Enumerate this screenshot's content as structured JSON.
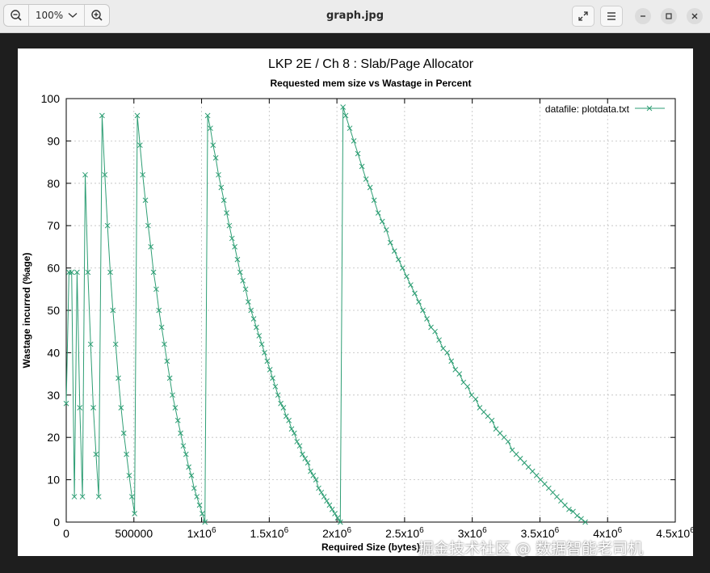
{
  "window": {
    "title": "graph.jpg",
    "zoom_level": "100%"
  },
  "icons": {
    "zoom_out": "zoom-out-icon",
    "zoom_in": "zoom-in-icon",
    "fullscreen": "fullscreen-icon",
    "menu": "hamburger-menu-icon",
    "minimize": "minimize-icon",
    "maximize": "maximize-icon",
    "close": "close-icon"
  },
  "watermark": "掘金技术社区 @ 数据智能老司机",
  "chart_data": {
    "type": "line",
    "title": "LKP 2E / Ch 8 : Slab/Page Allocator",
    "subtitle": "Requested mem size vs Wastage in Percent",
    "xlabel": "Required Size (bytes)",
    "ylabel": "Wastage incurred (%age)",
    "xlim": [
      0,
      4500000
    ],
    "ylim": [
      0,
      100
    ],
    "x_ticks": [
      {
        "value": 0,
        "label": "0"
      },
      {
        "value": 500000,
        "label": "500000"
      },
      {
        "value": 1000000,
        "label": "1x10",
        "sup": "6"
      },
      {
        "value": 1500000,
        "label": "1.5x10",
        "sup": "6"
      },
      {
        "value": 2000000,
        "label": "2x10",
        "sup": "6"
      },
      {
        "value": 2500000,
        "label": "2.5x10",
        "sup": "6"
      },
      {
        "value": 3000000,
        "label": "3x10",
        "sup": "6"
      },
      {
        "value": 3500000,
        "label": "3.5x10",
        "sup": "6"
      },
      {
        "value": 4000000,
        "label": "4x10",
        "sup": "6"
      },
      {
        "value": 4500000,
        "label": "4.5x10",
        "sup": "6"
      }
    ],
    "y_ticks": [
      0,
      10,
      20,
      30,
      40,
      50,
      60,
      70,
      80,
      90,
      100
    ],
    "grid": true,
    "legend_position": "top-right",
    "colors": {
      "series": "#2e9e74"
    },
    "series": [
      {
        "name": "datafile: plotdata.txt",
        "points": [
          [
            0,
            28
          ],
          [
            20000,
            59
          ],
          [
            40000,
            59
          ],
          [
            60000,
            6
          ],
          [
            80000,
            59
          ],
          [
            100000,
            27
          ],
          [
            120000,
            6
          ],
          [
            140000,
            82
          ],
          [
            160000,
            59
          ],
          [
            180000,
            42
          ],
          [
            200000,
            27
          ],
          [
            220000,
            16
          ],
          [
            240000,
            6
          ],
          [
            265000,
            96
          ],
          [
            285000,
            82
          ],
          [
            305000,
            70
          ],
          [
            325000,
            59
          ],
          [
            345000,
            50
          ],
          [
            365000,
            42
          ],
          [
            385000,
            34
          ],
          [
            405000,
            27
          ],
          [
            425000,
            21
          ],
          [
            445000,
            16
          ],
          [
            465000,
            11
          ],
          [
            485000,
            6
          ],
          [
            505000,
            2
          ],
          [
            525000,
            96
          ],
          [
            545000,
            89
          ],
          [
            565000,
            82
          ],
          [
            585000,
            76
          ],
          [
            605000,
            70
          ],
          [
            625000,
            65
          ],
          [
            645000,
            59
          ],
          [
            665000,
            55
          ],
          [
            685000,
            50
          ],
          [
            705000,
            46
          ],
          [
            725000,
            42
          ],
          [
            745000,
            38
          ],
          [
            765000,
            34
          ],
          [
            785000,
            30
          ],
          [
            805000,
            27
          ],
          [
            825000,
            24
          ],
          [
            845000,
            21
          ],
          [
            865000,
            18
          ],
          [
            885000,
            16
          ],
          [
            905000,
            13
          ],
          [
            925000,
            11
          ],
          [
            945000,
            8
          ],
          [
            965000,
            6
          ],
          [
            985000,
            4
          ],
          [
            1005000,
            2
          ],
          [
            1025000,
            0
          ],
          [
            1045000,
            96
          ],
          [
            1065000,
            93
          ],
          [
            1085000,
            89
          ],
          [
            1105000,
            86
          ],
          [
            1125000,
            82
          ],
          [
            1145000,
            79
          ],
          [
            1165000,
            76
          ],
          [
            1185000,
            73
          ],
          [
            1205000,
            70
          ],
          [
            1225000,
            67
          ],
          [
            1245000,
            65
          ],
          [
            1265000,
            62
          ],
          [
            1285000,
            59
          ],
          [
            1305000,
            57
          ],
          [
            1325000,
            55
          ],
          [
            1345000,
            52
          ],
          [
            1365000,
            50
          ],
          [
            1385000,
            48
          ],
          [
            1405000,
            46
          ],
          [
            1425000,
            44
          ],
          [
            1445000,
            42
          ],
          [
            1465000,
            40
          ],
          [
            1485000,
            38
          ],
          [
            1505000,
            36
          ],
          [
            1525000,
            34
          ],
          [
            1545000,
            32
          ],
          [
            1565000,
            30
          ],
          [
            1585000,
            28
          ],
          [
            1605000,
            27
          ],
          [
            1625000,
            25
          ],
          [
            1645000,
            24
          ],
          [
            1665000,
            22
          ],
          [
            1685000,
            21
          ],
          [
            1705000,
            19
          ],
          [
            1725000,
            18
          ],
          [
            1745000,
            16
          ],
          [
            1765000,
            15
          ],
          [
            1785000,
            14
          ],
          [
            1805000,
            12
          ],
          [
            1825000,
            11
          ],
          [
            1845000,
            10
          ],
          [
            1865000,
            8
          ],
          [
            1885000,
            7
          ],
          [
            1905000,
            6
          ],
          [
            1925000,
            5
          ],
          [
            1945000,
            4
          ],
          [
            1965000,
            3
          ],
          [
            1985000,
            2
          ],
          [
            2005000,
            1
          ],
          [
            2025000,
            0
          ],
          [
            2045000,
            98
          ],
          [
            2065000,
            96
          ],
          [
            2095000,
            93
          ],
          [
            2125000,
            90
          ],
          [
            2155000,
            87
          ],
          [
            2185000,
            84
          ],
          [
            2215000,
            81
          ],
          [
            2245000,
            79
          ],
          [
            2275000,
            76
          ],
          [
            2305000,
            73
          ],
          [
            2335000,
            71
          ],
          [
            2365000,
            69
          ],
          [
            2395000,
            66
          ],
          [
            2425000,
            64
          ],
          [
            2455000,
            62
          ],
          [
            2485000,
            60
          ],
          [
            2515000,
            58
          ],
          [
            2545000,
            56
          ],
          [
            2575000,
            54
          ],
          [
            2605000,
            52
          ],
          [
            2635000,
            50
          ],
          [
            2665000,
            48
          ],
          [
            2695000,
            46
          ],
          [
            2725000,
            45
          ],
          [
            2755000,
            43
          ],
          [
            2785000,
            41
          ],
          [
            2815000,
            40
          ],
          [
            2845000,
            38
          ],
          [
            2875000,
            36
          ],
          [
            2905000,
            35
          ],
          [
            2935000,
            33
          ],
          [
            2965000,
            32
          ],
          [
            2995000,
            30
          ],
          [
            3025000,
            29
          ],
          [
            3055000,
            27
          ],
          [
            3085000,
            26
          ],
          [
            3115000,
            25
          ],
          [
            3145000,
            24
          ],
          [
            3175000,
            22
          ],
          [
            3205000,
            21
          ],
          [
            3235000,
            20
          ],
          [
            3265000,
            19
          ],
          [
            3295000,
            17
          ],
          [
            3325000,
            16
          ],
          [
            3355000,
            15
          ],
          [
            3385000,
            14
          ],
          [
            3415000,
            13
          ],
          [
            3445000,
            12
          ],
          [
            3475000,
            11
          ],
          [
            3505000,
            10
          ],
          [
            3535000,
            9
          ],
          [
            3565000,
            8
          ],
          [
            3595000,
            7
          ],
          [
            3625000,
            6
          ],
          [
            3655000,
            5
          ],
          [
            3685000,
            4
          ],
          [
            3715000,
            3
          ],
          [
            3745000,
            2.5
          ],
          [
            3775000,
            1.5
          ],
          [
            3805000,
            0.8
          ],
          [
            3835000,
            0
          ]
        ]
      }
    ]
  }
}
